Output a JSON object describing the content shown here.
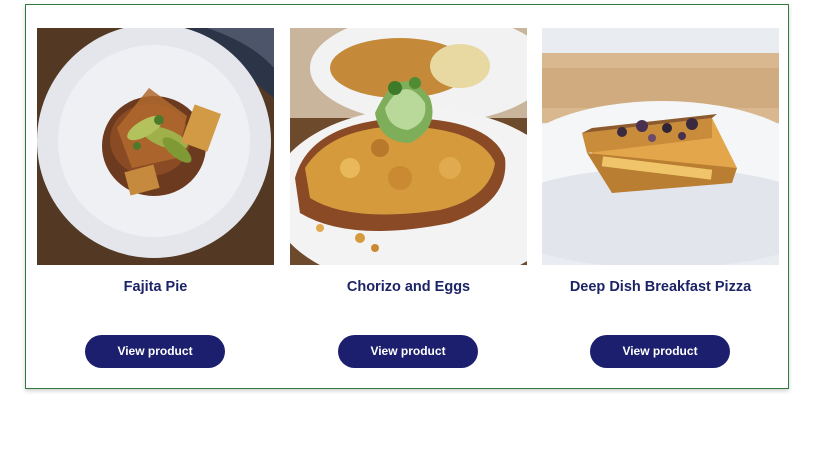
{
  "products": [
    {
      "title": "Fajita Pie",
      "button_label": "View product"
    },
    {
      "title": "Chorizo and Eggs",
      "button_label": "View product"
    },
    {
      "title": "Deep Dish Breakfast Pizza",
      "button_label": "View product"
    }
  ]
}
